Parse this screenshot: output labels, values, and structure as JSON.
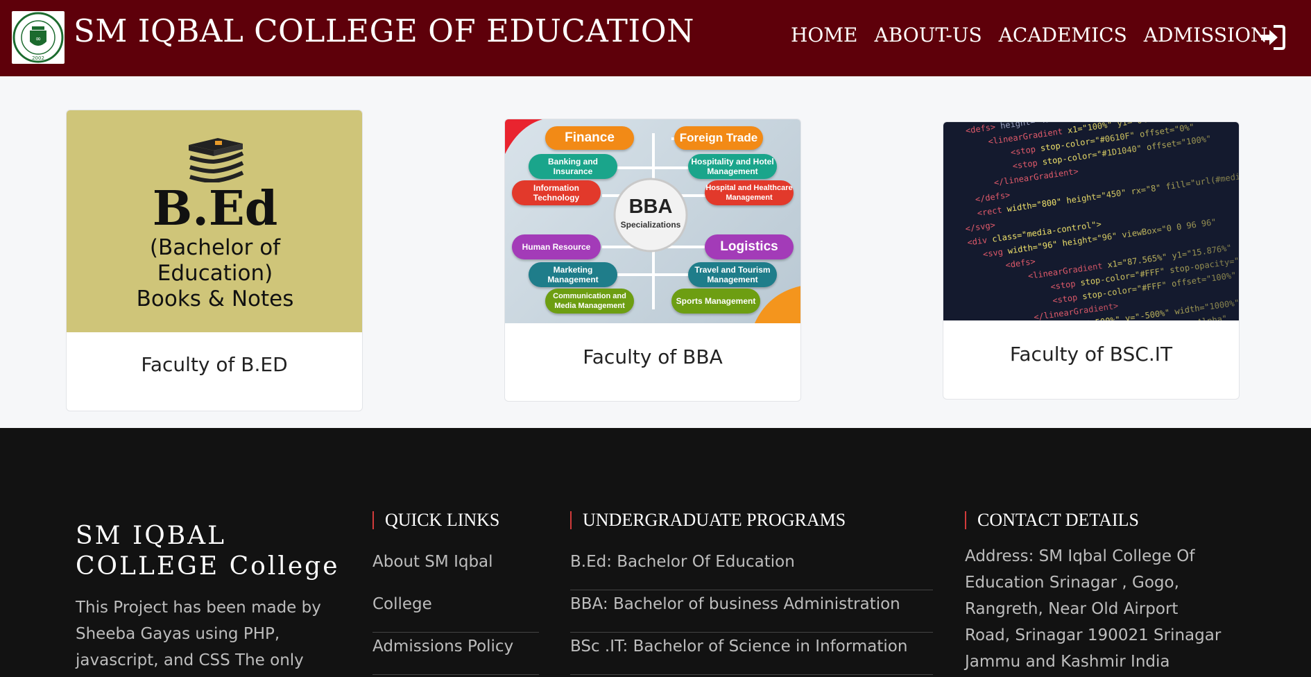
{
  "navbar": {
    "brand": "SM IQBAL COLLEGE OF EDUCATION",
    "logo_text": "DR S M IQBAL EDUCATIONAL SOCIETY 2002",
    "links": [
      "HOME",
      "ABOUT-US",
      "ACADEMICS",
      "ADMISSION"
    ],
    "login_icon": "sign-in-icon",
    "background": "#5e000a"
  },
  "cards": {
    "bed": {
      "title": "Faculty of B.ED",
      "image": {
        "heading": "B.Ed",
        "line1": "(Bachelor of",
        "line2": "Education)",
        "line3": "Books & Notes"
      }
    },
    "bba": {
      "title": "Faculty of BBA",
      "image": {
        "center_title": "BBA",
        "center_sub": "Specializations",
        "pills": [
          "Finance",
          "Foreign Trade",
          "Banking and Insurance",
          "Hospitality and Hotel Management",
          "Information Technology",
          "Hospital and Healthcare Management",
          "Human Resource",
          "Logistics",
          "Marketing Management",
          "Travel and Tourism Management",
          "Communication and Media Management",
          "Sports Management"
        ]
      }
    },
    "it": {
      "title": "Faculty of BSC.IT"
    }
  },
  "footer": {
    "brand": "SM IQBAL COLLEGE College",
    "description": "This Project has been made by Sheeba Gayas using PHP, javascript, and CSS The only purpose of this",
    "quick_links": {
      "heading": "QUICK LINKS",
      "items": [
        "About SM Iqbal",
        "College",
        "Admissions Policy"
      ]
    },
    "programs": {
      "heading": "UNDERGRADUATE PROGRAMS",
      "items": [
        "B.Ed: Bachelor Of Education",
        "BBA: Bachelor of business Administration",
        "BSc .IT: Bachelor of Science in Information"
      ]
    },
    "contact": {
      "heading": "CONTACT DETAILS",
      "address": "Address: SM Iqbal College Of Education Srinagar , Gogo, Rangreth, Near Old Airport Road, Srinagar 190021 Srinagar Jammu and Kashmir India"
    }
  }
}
